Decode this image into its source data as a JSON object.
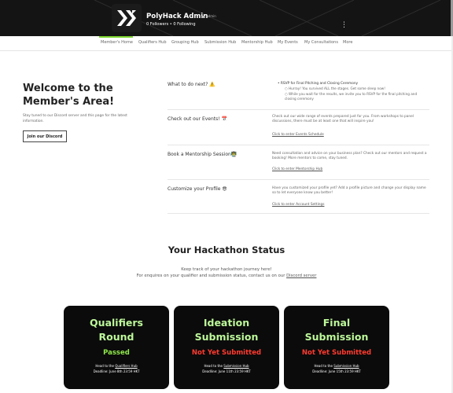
{
  "header": {
    "profile_name": "PolyHack Admin",
    "badge": "Admin",
    "followers": "0 Followers",
    "following": "0 Following",
    "follow_text": "0 Followers • 0 Following",
    "kebab": "⋮"
  },
  "nav": {
    "items": [
      "Member's Home",
      "Qualifiers Hub",
      "Grouping Hub",
      "Submission Hub",
      "Mentorship Hub",
      "My Events",
      "My Consultations",
      "More"
    ],
    "active_color": "#7fd832"
  },
  "welcome": {
    "title": "Welcome to the Member's Area!",
    "subtitle": "Stay tuned to our Discord server and this page for the latest information.",
    "button": "Join our Discord"
  },
  "rows": [
    {
      "title": "What to do next? ⚠️",
      "bullet": "RSVP for Final Pitching and Closing Ceremony",
      "sub1": "Hurray! You survived ALL the stages. Get some sleep now!",
      "sub2": "While you wait for the results, we invite you to RSVP for the final pitching and closing ceremony"
    },
    {
      "title": "Check out our Events! 📅",
      "text": "Check out our wide range of events prepared just for you. From workshops to panel discussions, there must be at least one that will inspire you!",
      "link": "Click to enter Events Schedule"
    },
    {
      "title": "Book a Mentorship Session👨‍🏫",
      "text": "Need consultation and advice on your business plan? Check out our mentors and request a booking! More mentors to come, stay tuned.",
      "link": "Click to enter Mentorship Hub"
    },
    {
      "title": "Customize your Profile 😎",
      "text": "Have you customized your profile yet? Add a profile picture and change your display name so to let everyone know you better!",
      "link": "Click to enter Account Settings"
    }
  ],
  "hackathon": {
    "title": "Your Hackathon Status",
    "line1": "Keep track of your hackathon journey here!",
    "line2_prefix": "For enquires on your qualifier and submission status, contact us on our ",
    "line2_link": "Discord server"
  },
  "cards": [
    {
      "line1": "Qualifiers",
      "line2": "Round",
      "status": "Passed",
      "status_class": "pass",
      "head_prefix": "Head to the ",
      "head_link": "Qualifiers Hub",
      "deadline": "Deadline: June 8th 23:59 HKT"
    },
    {
      "line1": "Ideation",
      "line2": "Submission",
      "status": "Not Yet Submitted",
      "status_class": "fail",
      "head_prefix": "Head to the ",
      "head_link": "Submission Hub",
      "deadline": "Deadline: June 11th 23:59 HKT"
    },
    {
      "line1": "Final",
      "line2": "Submission",
      "status": "Not Yet Submitted",
      "status_class": "fail",
      "head_prefix": "Head to the ",
      "head_link": "Submission Hub",
      "deadline": "Deadline: June 15th 23:59 HKT"
    }
  ],
  "colors": {
    "passed": "#8fe84b",
    "not_submitted": "#ff3b30",
    "card_title": "#bdf89a",
    "header_bg": "#141414"
  }
}
